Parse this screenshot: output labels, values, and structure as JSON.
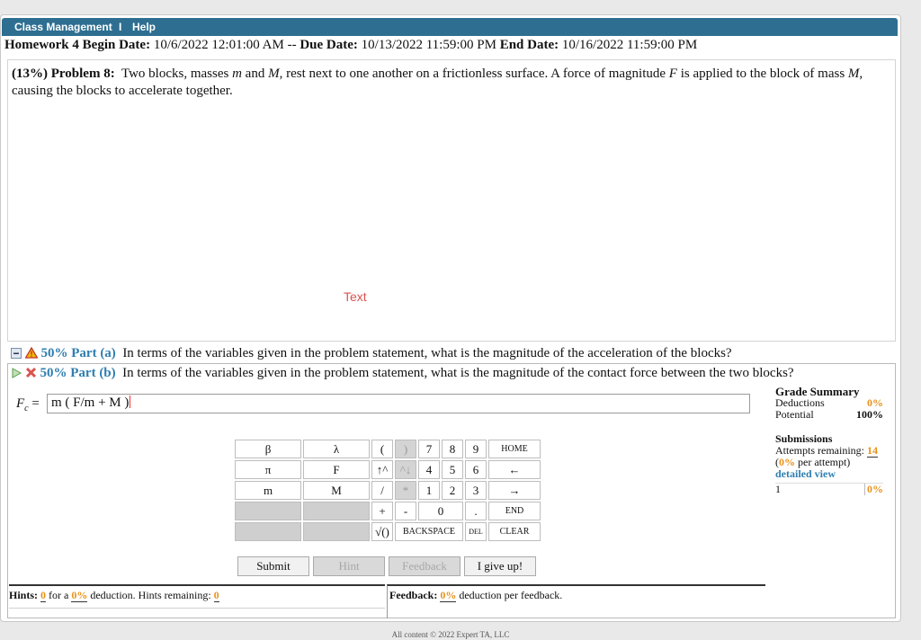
{
  "menu": {
    "class_mgmt": "Class Management",
    "separator": "I",
    "help": "Help"
  },
  "homework": {
    "name": "Homework 4",
    "begin_label": "Begin Date:",
    "begin": "10/6/2022 12:01:00 AM",
    "dash": "--",
    "due_label": "Due Date:",
    "due": "10/13/2022 11:59:00 PM",
    "end_label": "End Date:",
    "end": "10/16/2022 11:59:00 PM"
  },
  "problem": {
    "weight": "(13%)",
    "label": "Problem 8:",
    "text_1": "Two blocks, masses",
    "m": "m",
    "text_2": "and",
    "M": "M",
    "text_3": ", rest next to one another on a frictionless surface. A force of magnitude",
    "F": "F",
    "text_4": "is applied to the block of mass",
    "M2": "M",
    "text_5": ", causing the blocks to accelerate together.",
    "figure_text": "Text"
  },
  "parts": {
    "a": {
      "pct": "50% Part (a)",
      "text": "In terms of the variables given in the problem statement, what is the magnitude of the acceleration of the blocks?"
    },
    "b": {
      "pct": "50% Part (b)",
      "text": "In terms of the variables given in the problem statement, what is the magnitude of the contact force between the two blocks?"
    }
  },
  "answer": {
    "label_var": "F",
    "label_sub": "c",
    "equals": "=",
    "value": "m ( F/m + M )"
  },
  "grade": {
    "title": "Grade Summary",
    "deductions_label": "Deductions",
    "deductions": "0%",
    "potential_label": "Potential",
    "potential": "100%",
    "submissions_title": "Submissions",
    "attempts_label": "Attempts remaining:",
    "attempts": "14",
    "per_open": "(",
    "per_value": "0%",
    "per_label": "per attempt)",
    "detailed": "detailed view",
    "row_num": "1",
    "row_val": "0%"
  },
  "keypad": {
    "r1": [
      "β",
      "λ",
      "(",
      ")",
      "7",
      "8",
      "9",
      "HOME"
    ],
    "r2": [
      "π",
      "F",
      "↑^",
      "^↓",
      "4",
      "5",
      "6",
      "←"
    ],
    "r3": [
      "m",
      "M",
      "/",
      "*",
      "1",
      "2",
      "3",
      "→"
    ],
    "r4": [
      "+",
      "-",
      "0",
      ".",
      "END"
    ],
    "r5": [
      "√()",
      "BACKSPACE",
      "DEL",
      "CLEAR"
    ]
  },
  "buttons": {
    "submit": "Submit",
    "hint": "Hint",
    "feedback": "Feedback",
    "give_up": "I give up!"
  },
  "hints": {
    "label": "Hints:",
    "count": "0",
    "for_a": "for a",
    "pct": "0%",
    "deduction": "deduction. Hints remaining:",
    "remaining": "0"
  },
  "feedback": {
    "label": "Feedback:",
    "pct": "0%",
    "text": "deduction per feedback."
  },
  "footer": "All content © 2022 Expert TA, LLC"
}
